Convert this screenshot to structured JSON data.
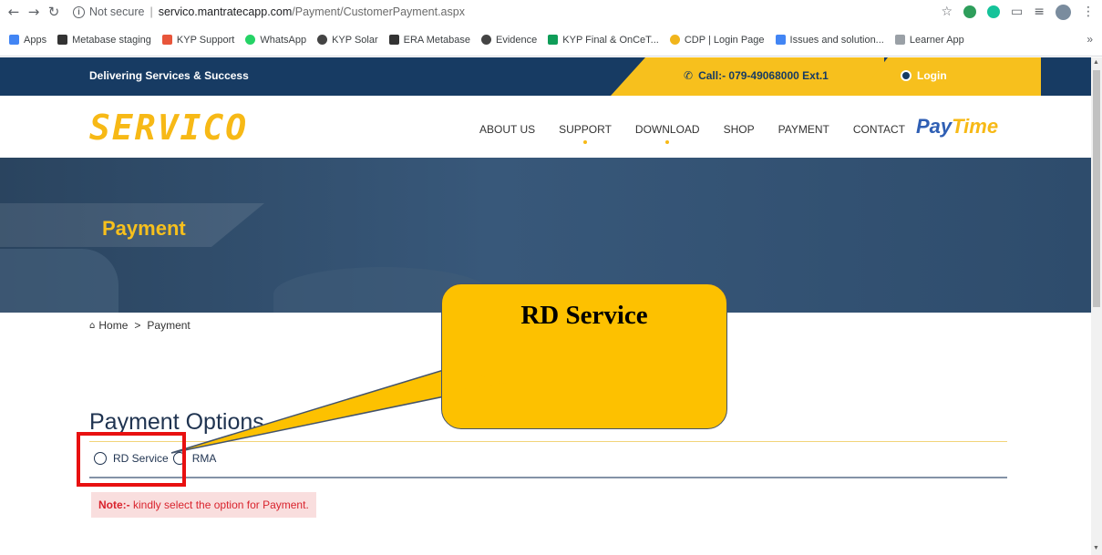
{
  "browser": {
    "security_text": "Not secure",
    "url_host": "servico.mantratecapp.com",
    "url_path": "/Payment/CustomerPayment.aspx",
    "bookmarks": [
      {
        "label": "Apps",
        "icon": "apps-grid-icon",
        "color": "#4285f4"
      },
      {
        "label": "Metabase staging",
        "icon": "metabase-icon",
        "color": "#333333"
      },
      {
        "label": "KYP Support",
        "icon": "pencil-icon",
        "color": "#e8553a"
      },
      {
        "label": "WhatsApp",
        "icon": "whatsapp-icon",
        "color": "#25d366"
      },
      {
        "label": "KYP Solar",
        "icon": "globe-icon",
        "color": "#444444"
      },
      {
        "label": "ERA Metabase",
        "icon": "metabase-icon",
        "color": "#333333"
      },
      {
        "label": "Evidence",
        "icon": "globe-icon",
        "color": "#444444"
      },
      {
        "label": "KYP Final & OnCeT...",
        "icon": "sheets-icon",
        "color": "#0f9d58"
      },
      {
        "label": "CDP | Login Page",
        "icon": "cdp-icon",
        "color": "#f1b51c"
      },
      {
        "label": "Issues and solution...",
        "icon": "docs-icon",
        "color": "#4285f4"
      },
      {
        "label": "Learner App",
        "icon": "learner-icon",
        "color": "#9aa0a6"
      }
    ],
    "more_label": "»"
  },
  "site": {
    "tagline": "Delivering Services & Success",
    "call_label": "Call:- 079-49068000 Ext.1",
    "login_label": "Login",
    "logo": "SERVICO",
    "nav": [
      "ABOUT US",
      "SUPPORT",
      "DOWNLOAD",
      "SHOP",
      "PAYMENT",
      "CONTACT"
    ],
    "paytime_a": "Pay",
    "paytime_b": "Time",
    "hero_title": "Payment",
    "breadcrumb": {
      "home": "Home",
      "sep": ">",
      "current": "Payment"
    }
  },
  "payment": {
    "heading": "Payment Options",
    "options": [
      "RD Service",
      "RMA"
    ],
    "note_prefix": "Note:-",
    "note_text": " kindly select the option for Payment."
  },
  "annotation": {
    "callout_text": "RD Service",
    "callout_color": "#fdc100",
    "highlight_color": "#e81010"
  }
}
